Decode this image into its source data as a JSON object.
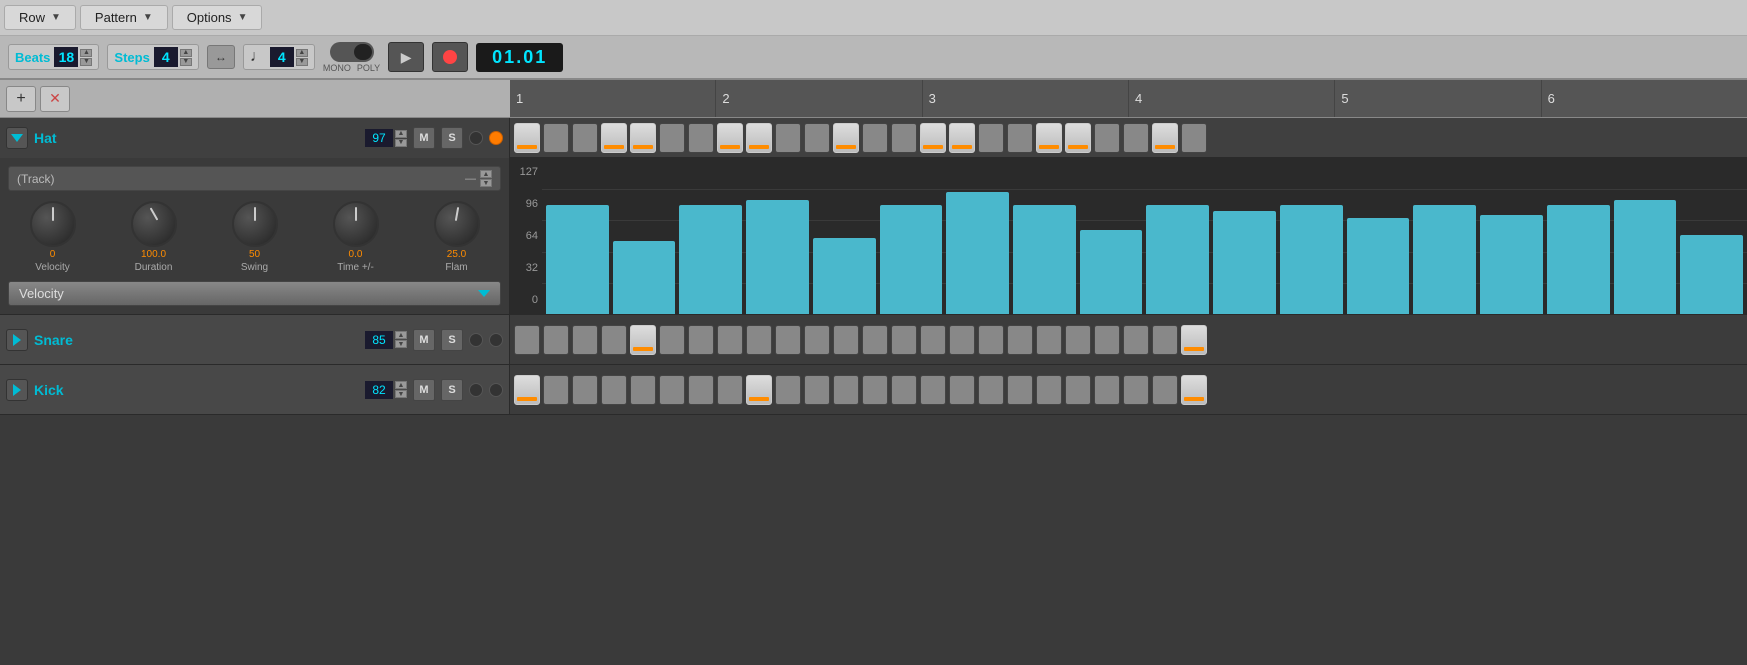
{
  "menu": {
    "row_label": "Row",
    "pattern_label": "Pattern",
    "options_label": "Options"
  },
  "transport": {
    "beats_label": "Beats",
    "beats_value": "18",
    "steps_label": "Steps",
    "steps_value": "4",
    "time_sig_value": "4",
    "mono_label": "MONO",
    "poly_label": "POLY",
    "time_display": "01.01"
  },
  "toolbar": {
    "add_label": "+",
    "remove_label": "✕"
  },
  "ruler": {
    "beats": [
      "1",
      "2",
      "3",
      "4",
      "5",
      "6"
    ]
  },
  "hat_track": {
    "name": "Hat",
    "volume": "97",
    "m_label": "M",
    "s_label": "S",
    "track_select": "(Track)",
    "knobs": [
      {
        "val": "0",
        "label": "Velocity"
      },
      {
        "val": "100.0",
        "label": "Duration"
      },
      {
        "val": "50",
        "label": "Swing"
      },
      {
        "val": "0.0",
        "label": "Time +/-"
      },
      {
        "val": "25.0",
        "label": "Flam"
      }
    ],
    "velocity_dropdown": "Velocity",
    "y_labels": [
      "127",
      "96",
      "64",
      "32",
      "0"
    ],
    "bar_heights_pct": [
      72,
      48,
      72,
      75,
      50,
      72,
      80,
      72,
      55,
      72,
      68,
      72,
      63,
      72,
      65,
      72,
      75,
      52
    ]
  },
  "snare_track": {
    "name": "Snare",
    "volume": "85",
    "m_label": "M",
    "s_label": "S"
  },
  "kick_track": {
    "name": "Kick",
    "volume": "82",
    "m_label": "M",
    "s_label": "S"
  },
  "colors": {
    "cyan": "#00bcd4",
    "orange": "#ff8c00",
    "bar_fill": "#4ab8cc"
  }
}
